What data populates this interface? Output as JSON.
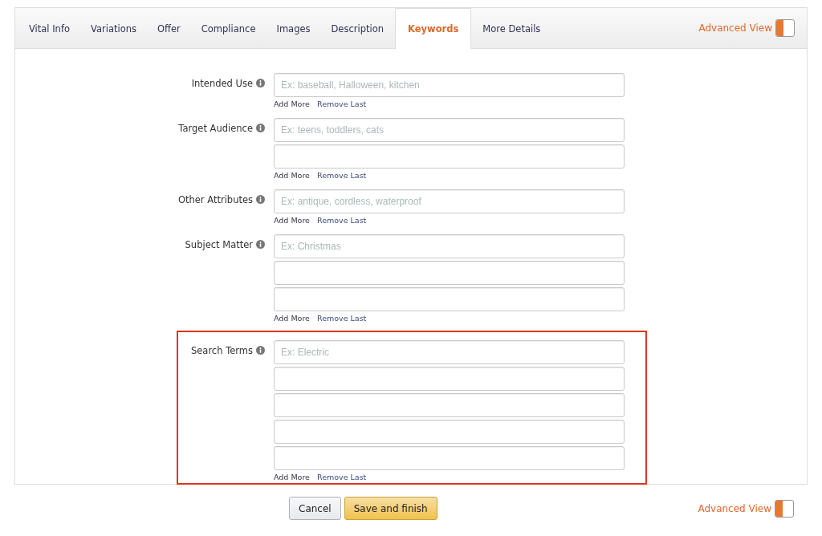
{
  "tabs": [
    {
      "label": "Vital Info",
      "selected": false
    },
    {
      "label": "Variations",
      "selected": false
    },
    {
      "label": "Offer",
      "selected": false
    },
    {
      "label": "Compliance",
      "selected": false
    },
    {
      "label": "Images",
      "selected": false
    },
    {
      "label": "Description",
      "selected": false
    },
    {
      "label": "Keywords",
      "selected": true
    },
    {
      "label": "More Details",
      "selected": false
    }
  ],
  "advanced_view_top": {
    "label": "Advanced View",
    "on": true
  },
  "fields": [
    {
      "label": "Intended Use",
      "highlighted": false,
      "inputs": [
        {
          "kind": "hint",
          "placeholder": "Ex: baseball, Halloween, kitchen"
        }
      ],
      "add_more": "Add More",
      "remove_last": "Remove Last"
    },
    {
      "label": "Target Audience",
      "highlighted": false,
      "inputs": [
        {
          "kind": "hint",
          "placeholder": "Ex: teens, toddlers, cats"
        },
        {
          "kind": "blank"
        }
      ],
      "add_more": "Add More",
      "remove_last": "Remove Last"
    },
    {
      "label": "Other Attributes",
      "highlighted": false,
      "inputs": [
        {
          "kind": "hint",
          "placeholder": "Ex: antique, cordless, waterproof"
        }
      ],
      "add_more": "Add More",
      "remove_last": "Remove Last"
    },
    {
      "label": "Subject Matter",
      "highlighted": false,
      "inputs": [
        {
          "kind": "hint",
          "placeholder": "Ex: Christmas"
        },
        {
          "kind": "blank"
        },
        {
          "kind": "blank"
        }
      ],
      "add_more": "Add More",
      "remove_last": "Remove Last"
    },
    {
      "label": "Search Terms",
      "highlighted": true,
      "inputs": [
        {
          "kind": "hint",
          "placeholder": "Ex: Electric"
        },
        {
          "kind": "blank"
        },
        {
          "kind": "blank"
        },
        {
          "kind": "blank"
        },
        {
          "kind": "blank"
        }
      ],
      "add_more": "Add More",
      "remove_last": "Remove Last"
    }
  ],
  "buttons": [
    {
      "label": "Cancel",
      "kind": "secondary"
    },
    {
      "label": "Save and finish",
      "kind": "primary"
    }
  ],
  "advanced_view_bottom": {
    "label": "Advanced View",
    "on": true
  }
}
